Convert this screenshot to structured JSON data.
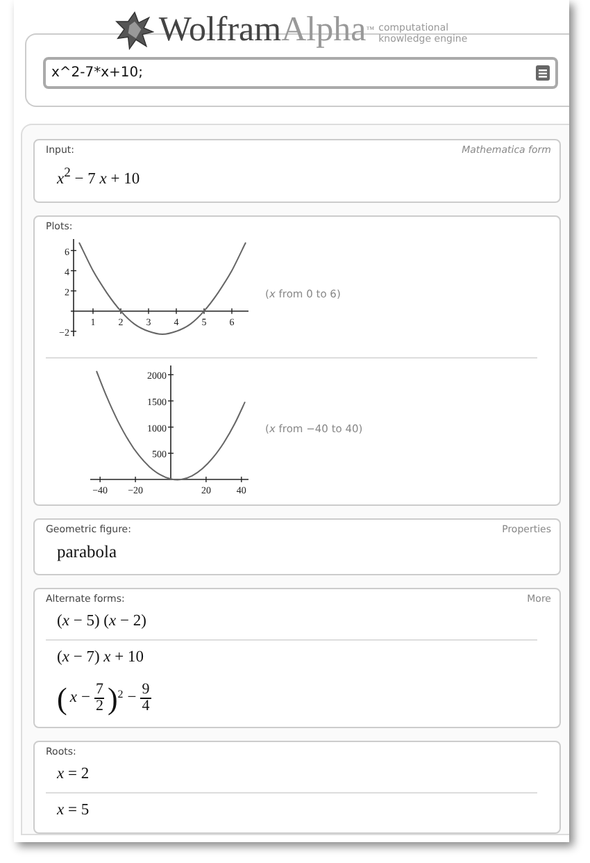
{
  "logo": {
    "name_dark": "Wolfram",
    "name_light": "Alpha",
    "trademark": "™",
    "tagline_1": "computational",
    "tagline_2": "knowledge engine"
  },
  "search": {
    "value": "x^2-7*x+10;"
  },
  "pods": [
    {
      "title": "Input:",
      "action": "Mathematica form",
      "rows": [
        {
          "kind": "math",
          "text": "*x*$^{2}$ − 7 *x* + 10",
          "divider": false
        }
      ]
    },
    {
      "title": "Plots:",
      "rows": [
        {
          "kind": "plot",
          "caption": "(*x* from 0 to 6)",
          "divider": true,
          "chart_data": {
            "type": "line",
            "xlim": [
              0.3,
              6.6
            ],
            "ylim": [
              -2.5,
              7
            ],
            "xticks": [
              1,
              2,
              3,
              4,
              5,
              6
            ],
            "yticks": [
              {
                "value": -2,
                "label": "−2"
              },
              2,
              4,
              6
            ],
            "x": [
              0.5,
              1,
              1.5,
              2,
              2.5,
              3,
              3.5,
              4,
              4.5,
              5,
              5.5,
              6,
              6.5
            ],
            "series": [
              {
                "color": "#666666",
                "values": [
                  6.8,
                  4,
                  1.8,
                  0,
                  -1.3,
                  -2,
                  -2.3,
                  -2,
                  -1.3,
                  0,
                  1.8,
                  4,
                  6.8
                ]
              }
            ]
          }
        },
        {
          "kind": "plot",
          "caption": "(*x* from −40 to 40)",
          "divider": false,
          "chart_data": {
            "type": "line",
            "xlim": [
              -44,
              44
            ],
            "ylim": [
              0,
              2150
            ],
            "xticks": [
              {
                "value": -40,
                "label": "−40"
              },
              {
                "value": -20,
                "label": "−20"
              },
              20,
              40
            ],
            "yticks": [
              500,
              1000,
              1500,
              2000
            ],
            "x": [
              -42,
              -36,
              -30,
              -24,
              -18,
              -12,
              -6,
              0,
              6,
              12,
              18,
              24,
              30,
              36,
              42
            ],
            "series": [
              {
                "color": "#666666",
                "values": [
                  2070,
                  1560,
                  1120,
                  750,
                  460,
                  240,
                  90,
                  10,
                  0,
                  70,
                  210,
                  420,
                  700,
                  1050,
                  1480
                ]
              }
            ]
          }
        }
      ]
    },
    {
      "title": "Geometric figure:",
      "action": "Properties",
      "rows": [
        {
          "kind": "word",
          "text": "parabola",
          "divider": false
        }
      ]
    },
    {
      "title": "Alternate forms:",
      "action": "More",
      "rows": [
        {
          "kind": "math",
          "text": "(*x* − 5) (*x* − 2)",
          "divider": true
        },
        {
          "kind": "math",
          "text": "(*x* − 7) *x* + 10",
          "divider": false
        },
        {
          "kind": "square",
          "open": "(",
          "var": "x",
          "minus": "−",
          "num": "7",
          "den": "2",
          "close": ")",
          "exp": "2",
          "minus2": "−",
          "num2": "9",
          "den2": "4",
          "divider": false
        }
      ]
    },
    {
      "title": "Roots:",
      "rows": [
        {
          "kind": "math",
          "text": "*x* = 2",
          "divider": true
        },
        {
          "kind": "math",
          "text": "*x* = 5",
          "divider": false
        }
      ]
    }
  ]
}
